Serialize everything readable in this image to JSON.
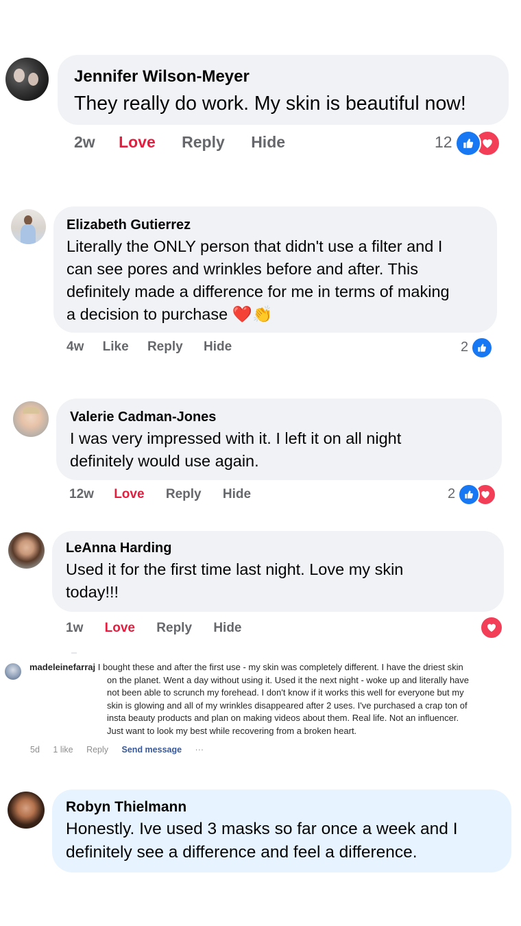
{
  "comments": [
    {
      "name": "Jennifer Wilson-Meyer",
      "lines": [
        "They really do work. My skin is beautiful now!"
      ],
      "time": "2w",
      "reaction_label": "Love",
      "reply": "Reply",
      "hide": "Hide",
      "count": "12",
      "icons": [
        "like-icon",
        "love-icon"
      ]
    },
    {
      "name": "Elizabeth Gutierrez",
      "lines": [
        "Literally the ONLY person that didn't use a filter and I",
        "can see pores and wrinkles before and after. This",
        "definitely made a difference for me in terms of making",
        "a decision to purchase"
      ],
      "emojis": [
        "❤️",
        "👏"
      ],
      "time": "4w",
      "reaction_label": "Like",
      "reply": "Reply",
      "hide": "Hide",
      "count": "2",
      "icons": [
        "like-icon"
      ]
    },
    {
      "name": "Valerie Cadman-Jones",
      "lines": [
        "I was very impressed with it. I left it on all night",
        "definitely would use again."
      ],
      "time": "12w",
      "reaction_label": "Love",
      "reply": "Reply",
      "hide": "Hide",
      "count": "2",
      "icons": [
        "like-icon",
        "love-icon"
      ]
    },
    {
      "name": "LeAnna Harding",
      "lines": [
        "Used it for the first time last night. Love my skin",
        "today!!!"
      ],
      "time": "1w",
      "reaction_label": "Love",
      "reply": "Reply",
      "hide": "Hide",
      "count": "",
      "icons": [
        "love-icon"
      ]
    },
    {
      "name": "Robyn Thielmann",
      "lines": [
        "Honestly. Ive used 3 masks so far once a week and I",
        "definitely see a difference and feel a difference."
      ]
    }
  ],
  "ig_comment": {
    "username": "madeleinefarraj",
    "lines": [
      "I bought these and after the first use - my skin was completely different. I have the driest skin",
      "on the planet. Went a day without using it. Used it the next night - woke up and literally have",
      "not been able to scrunch my forehead. I don't know if it works this well for everyone but my",
      "skin is glowing and all of my wrinkles disappeared after 2 uses. I've purchased a crap ton of",
      "insta beauty products and plan on making videos about them. Real life. Not an influencer.",
      "Just want to look my best while recovering from a broken heart."
    ],
    "time": "5d",
    "likes": "1 like",
    "reply": "Reply",
    "send": "Send message",
    "more": "···"
  },
  "colors": {
    "bubble": "#f0f2f5",
    "bubble_highlight": "#e7f3ff",
    "love": "#e41e3f",
    "meta": "#65676b",
    "like_blue": "#1877f2",
    "love_red": "#f33e58"
  }
}
